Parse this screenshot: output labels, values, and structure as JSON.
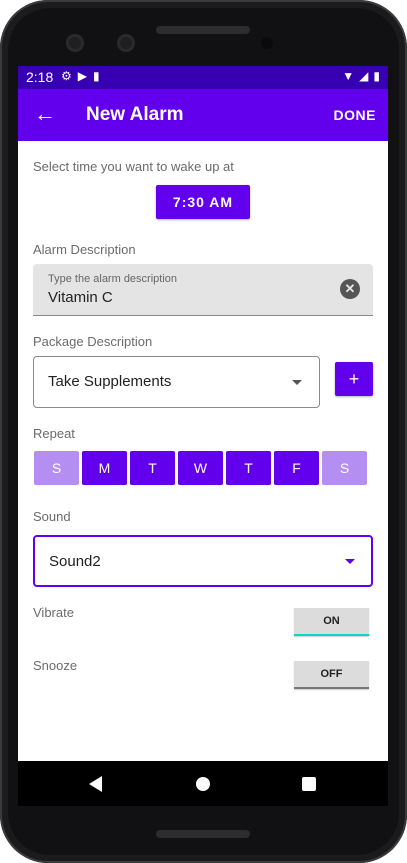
{
  "status": {
    "time": "2:18"
  },
  "appbar": {
    "title": "New Alarm",
    "done_label": "DONE"
  },
  "time_section": {
    "label": "Select time you want to wake up at",
    "time_value": "7:30  AM"
  },
  "alarm_description": {
    "label": "Alarm Description",
    "hint": "Type the alarm description",
    "value": "Vitamin C"
  },
  "package_description": {
    "label": "Package Description",
    "selected": "Take Supplements",
    "add_label": "+"
  },
  "repeat": {
    "label": "Repeat",
    "days": [
      {
        "label": "S",
        "selected": false
      },
      {
        "label": "M",
        "selected": true
      },
      {
        "label": "T",
        "selected": true
      },
      {
        "label": "W",
        "selected": true
      },
      {
        "label": "T",
        "selected": true
      },
      {
        "label": "F",
        "selected": true
      },
      {
        "label": "S",
        "selected": false
      }
    ]
  },
  "sound": {
    "label": "Sound",
    "selected": "Sound2"
  },
  "vibrate": {
    "label": "Vibrate",
    "state": "ON"
  },
  "snooze": {
    "label": "Snooze",
    "state": "OFF"
  },
  "colors": {
    "primary": "#6200ee",
    "primary_dark": "#3700b3",
    "accent": "#03dac5",
    "day_unselected": "#b48ef1"
  }
}
